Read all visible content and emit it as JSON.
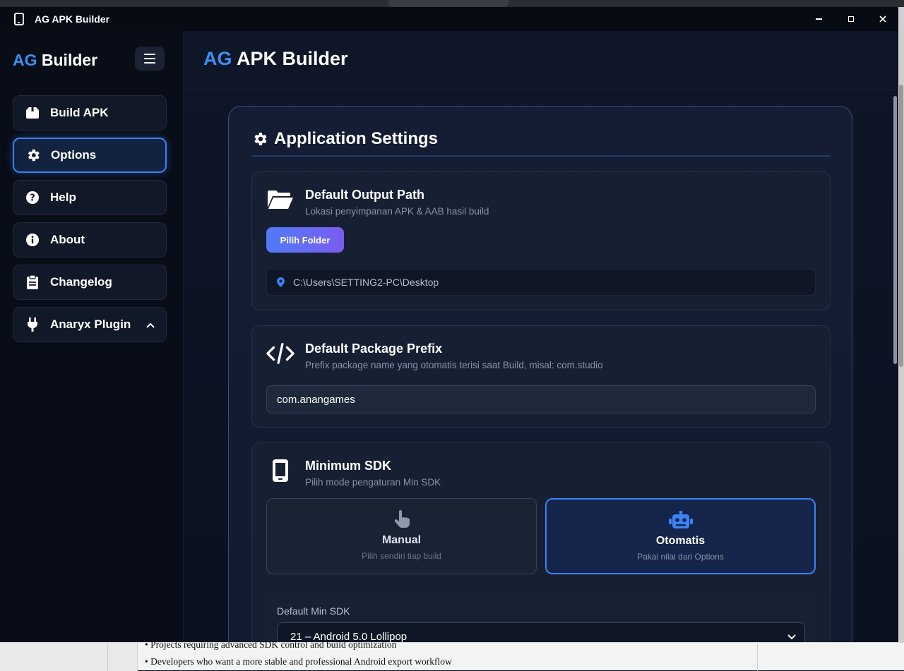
{
  "window": {
    "title": "AG APK Builder",
    "controls": {
      "minimize": "–",
      "maximize": "□",
      "close": "✕"
    }
  },
  "sidebar": {
    "brand_prefix": "AG",
    "brand_suffix": "Builder",
    "items": [
      {
        "label": "Build APK",
        "icon": "box-icon",
        "active": false
      },
      {
        "label": "Options",
        "icon": "gear-icon",
        "active": true
      },
      {
        "label": "Help",
        "icon": "question-circle-icon",
        "active": false
      },
      {
        "label": "About",
        "icon": "info-circle-icon",
        "active": false
      },
      {
        "label": "Changelog",
        "icon": "clipboard-icon",
        "active": false
      },
      {
        "label": "Anaryx Plugin",
        "icon": "plug-icon",
        "active": false,
        "expanded": true
      }
    ]
  },
  "header": {
    "title_prefix": "AG",
    "title_suffix": "APK Builder"
  },
  "settings": {
    "title": "Application Settings",
    "output_path": {
      "title": "Default Output Path",
      "description": "Lokasi penyimpanan APK & AAB hasil build",
      "button_label": "Pilih Folder",
      "path": "C:\\Users\\SETTING2-PC\\Desktop"
    },
    "package_prefix": {
      "title": "Default Package Prefix",
      "description": "Prefix package name yang otomatis terisi saat Build, misal: com.studio",
      "value": "com.anangames"
    },
    "min_sdk": {
      "title": "Minimum SDK",
      "description": "Pilih mode pengaturan Min SDK",
      "modes": [
        {
          "title": "Manual",
          "subtitle": "Pilih sendiri tiap build",
          "selected": false
        },
        {
          "title": "Otomatis",
          "subtitle": "Pakai nilai dari Options",
          "selected": true
        }
      ],
      "default_label": "Default Min SDK",
      "default_value": "21 – Android 5.0 Lollipop"
    }
  },
  "background_app": {
    "lines": [
      "• Projects requiring advanced SDK control and build optimization",
      "• Developers who want a more stable and professional Android export workflow"
    ]
  },
  "colors": {
    "accent": "#3b82f6",
    "brand_blue": "#3b8ff0",
    "button_gradient_start": "#4f7bf7",
    "button_gradient_end": "#7b5cf0"
  }
}
